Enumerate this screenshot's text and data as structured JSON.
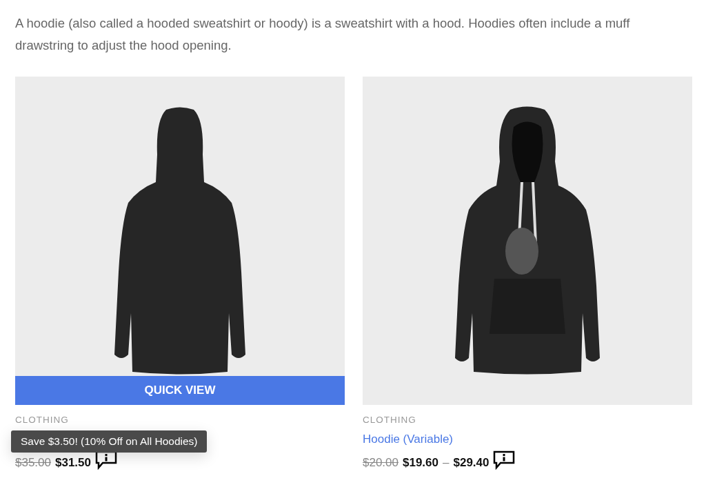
{
  "description": [
    "A hoodie (also called a hooded sweatshirt or hoody) is a sweatshirt with a hood. Hoodies often include a muff",
    "drawstring to adjust the hood opening."
  ],
  "products": [
    {
      "kind": "back",
      "quick_view": "QUICK VIEW",
      "category": "CLOTHING",
      "old_price": "$35.00",
      "price": "$31.50",
      "tooltip": "Save $3.50! (10% Off on All Hoodies)"
    },
    {
      "kind": "front",
      "category": "CLOTHING",
      "title": "Hoodie (Variable)",
      "old_price": "$20.00",
      "price": "$19.60",
      "separator": "–",
      "price_max": "$29.40"
    }
  ]
}
